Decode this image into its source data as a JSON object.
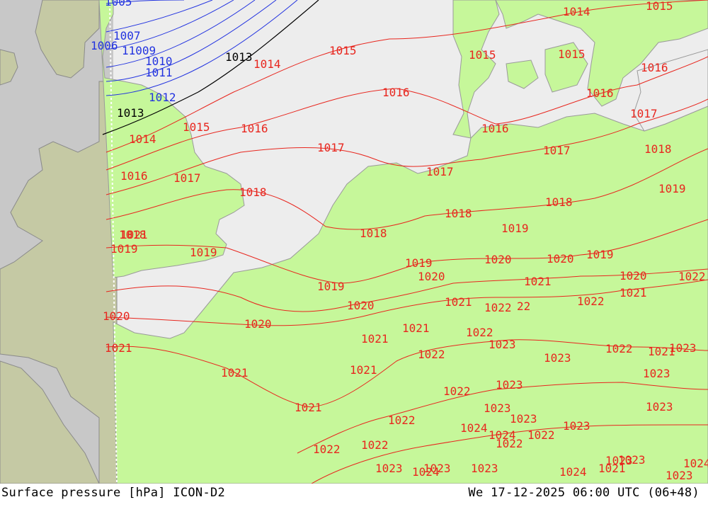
{
  "map": {
    "colors": {
      "sea": "#ededed",
      "land_domain": "#c6f79a",
      "land_outside": "#c5c9a4",
      "sea_outside": "#c8c8c8",
      "isobar_high": "#e8261e",
      "isobar_low": "#2233e0",
      "isobar_ref": "#000000",
      "coast": "#9a9a9a"
    },
    "isobar_labels": [
      {
        "text": "1005",
        "color": "blue"
      },
      {
        "text": "1007",
        "color": "blue"
      },
      {
        "text": "1006",
        "color": "blue"
      },
      {
        "text": "11009",
        "color": "blue"
      },
      {
        "text": "1010",
        "color": "blue"
      },
      {
        "text": "1011",
        "color": "blue"
      },
      {
        "text": "1012",
        "color": "blue"
      },
      {
        "text": "1013",
        "color": "black"
      },
      {
        "text": "1013",
        "color": "black"
      },
      {
        "text": "1014",
        "color": "red"
      },
      {
        "text": "1014",
        "color": "red"
      },
      {
        "text": "1014",
        "color": "red"
      },
      {
        "text": "1015",
        "color": "red"
      },
      {
        "text": "1015",
        "color": "red"
      },
      {
        "text": "1015",
        "color": "red"
      },
      {
        "text": "1015",
        "color": "red"
      },
      {
        "text": "1015",
        "color": "red"
      },
      {
        "text": "1016",
        "color": "red"
      },
      {
        "text": "1016",
        "color": "red"
      },
      {
        "text": "1016",
        "color": "red"
      },
      {
        "text": "1016",
        "color": "red"
      },
      {
        "text": "1016",
        "color": "red"
      },
      {
        "text": "1016",
        "color": "red"
      },
      {
        "text": "1017",
        "color": "red"
      },
      {
        "text": "1017",
        "color": "red"
      },
      {
        "text": "1017",
        "color": "red"
      },
      {
        "text": "1017",
        "color": "red"
      },
      {
        "text": "1017",
        "color": "red"
      },
      {
        "text": "1018",
        "color": "red"
      },
      {
        "text": "1018",
        "color": "red"
      },
      {
        "text": "1018",
        "color": "red"
      },
      {
        "text": "1018",
        "color": "red"
      },
      {
        "text": "1018",
        "color": "red"
      },
      {
        "text": "1018",
        "color": "red"
      },
      {
        "text": "1019",
        "color": "red"
      },
      {
        "text": "1019",
        "color": "red"
      },
      {
        "text": "1019",
        "color": "red"
      },
      {
        "text": "1019",
        "color": "red"
      },
      {
        "text": "1019",
        "color": "red"
      },
      {
        "text": "1019",
        "color": "red"
      },
      {
        "text": "1019",
        "color": "red"
      },
      {
        "text": "1020",
        "color": "red"
      },
      {
        "text": "1020",
        "color": "red"
      },
      {
        "text": "1020",
        "color": "red"
      },
      {
        "text": "1020",
        "color": "red"
      },
      {
        "text": "1020",
        "color": "red"
      },
      {
        "text": "1020",
        "color": "red"
      },
      {
        "text": "1020",
        "color": "red"
      },
      {
        "text": "1021",
        "color": "red"
      },
      {
        "text": "1021",
        "color": "red"
      },
      {
        "text": "1021",
        "color": "red"
      },
      {
        "text": "1021",
        "color": "red"
      },
      {
        "text": "1021",
        "color": "red"
      },
      {
        "text": "1021",
        "color": "red"
      },
      {
        "text": "1021",
        "color": "red"
      },
      {
        "text": "1021",
        "color": "red"
      },
      {
        "text": "1021",
        "color": "red"
      },
      {
        "text": "1021",
        "color": "red"
      },
      {
        "text": "1021",
        "color": "red"
      },
      {
        "text": "1022",
        "color": "red"
      },
      {
        "text": "1022",
        "color": "red"
      },
      {
        "text": "1022",
        "color": "red"
      },
      {
        "text": "1022",
        "color": "red"
      },
      {
        "text": "1022",
        "color": "red"
      },
      {
        "text": "1022",
        "color": "red"
      },
      {
        "text": "1022",
        "color": "red"
      },
      {
        "text": "1022",
        "color": "red"
      },
      {
        "text": "1022",
        "color": "red"
      },
      {
        "text": "1022",
        "color": "red"
      },
      {
        "text": "1022",
        "color": "red"
      },
      {
        "text": "22",
        "color": "red"
      },
      {
        "text": "1023",
        "color": "red"
      },
      {
        "text": "1023",
        "color": "red"
      },
      {
        "text": "1023",
        "color": "red"
      },
      {
        "text": "1023",
        "color": "red"
      },
      {
        "text": "1023",
        "color": "red"
      },
      {
        "text": "1023",
        "color": "red"
      },
      {
        "text": "1023",
        "color": "red"
      },
      {
        "text": "1023",
        "color": "red"
      },
      {
        "text": "1023",
        "color": "red"
      },
      {
        "text": "1023",
        "color": "red"
      },
      {
        "text": "1023",
        "color": "red"
      },
      {
        "text": "1023",
        "color": "red"
      },
      {
        "text": "1023",
        "color": "red"
      },
      {
        "text": "1023",
        "color": "red"
      },
      {
        "text": "1024",
        "color": "red"
      },
      {
        "text": "1024",
        "color": "red"
      },
      {
        "text": "1024",
        "color": "red"
      },
      {
        "text": "1024",
        "color": "red"
      },
      {
        "text": "1024",
        "color": "red"
      },
      {
        "text": "1021",
        "color": "red"
      },
      {
        "text": "1023",
        "color": "red"
      },
      {
        "text": "1022",
        "color": "red"
      }
    ]
  },
  "footer": {
    "left": "Surface pressure [hPa] ICON-D2",
    "right": "We 17-12-2025 06:00 UTC (06+48)"
  }
}
